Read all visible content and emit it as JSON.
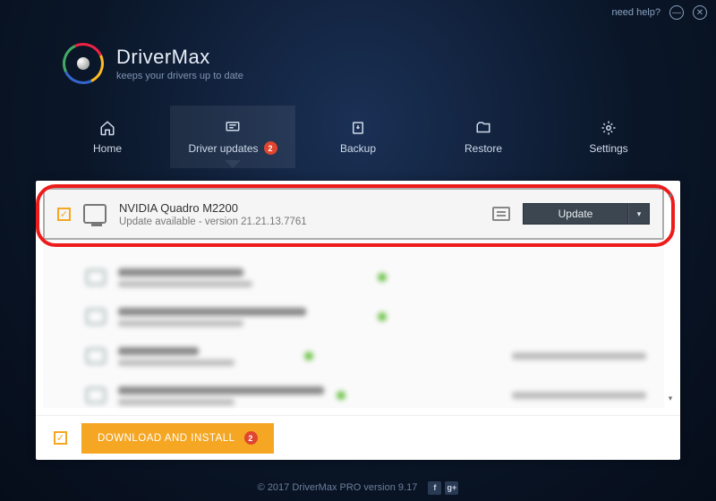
{
  "topbar": {
    "help": "need help?"
  },
  "brand": {
    "title": "DriverMax",
    "subtitle": "keeps your drivers up to date"
  },
  "tabs": {
    "home": "Home",
    "updates": "Driver updates",
    "updates_badge": "2",
    "backup": "Backup",
    "restore": "Restore",
    "settings": "Settings"
  },
  "driver": {
    "name": "NVIDIA Quadro M2200",
    "status": "Update available - version 21.21.13.7761",
    "button": "Update"
  },
  "blur_rows": [
    {
      "title_w": 140,
      "sub_w": 150,
      "dot": "#6ec24a",
      "right_w": 0
    },
    {
      "title_w": 210,
      "sub_w": 140,
      "dot": "#6ec24a",
      "right_w": 0
    },
    {
      "title_w": 90,
      "sub_w": 130,
      "dot": "#6ec24a",
      "right_w": 150
    },
    {
      "title_w": 230,
      "sub_w": 130,
      "dot": "#6ec24a",
      "right_w": 150
    }
  ],
  "download": {
    "label": "DOWNLOAD AND INSTALL",
    "badge": "2"
  },
  "footer": {
    "text": "© 2017 DriverMax PRO version 9.17"
  }
}
